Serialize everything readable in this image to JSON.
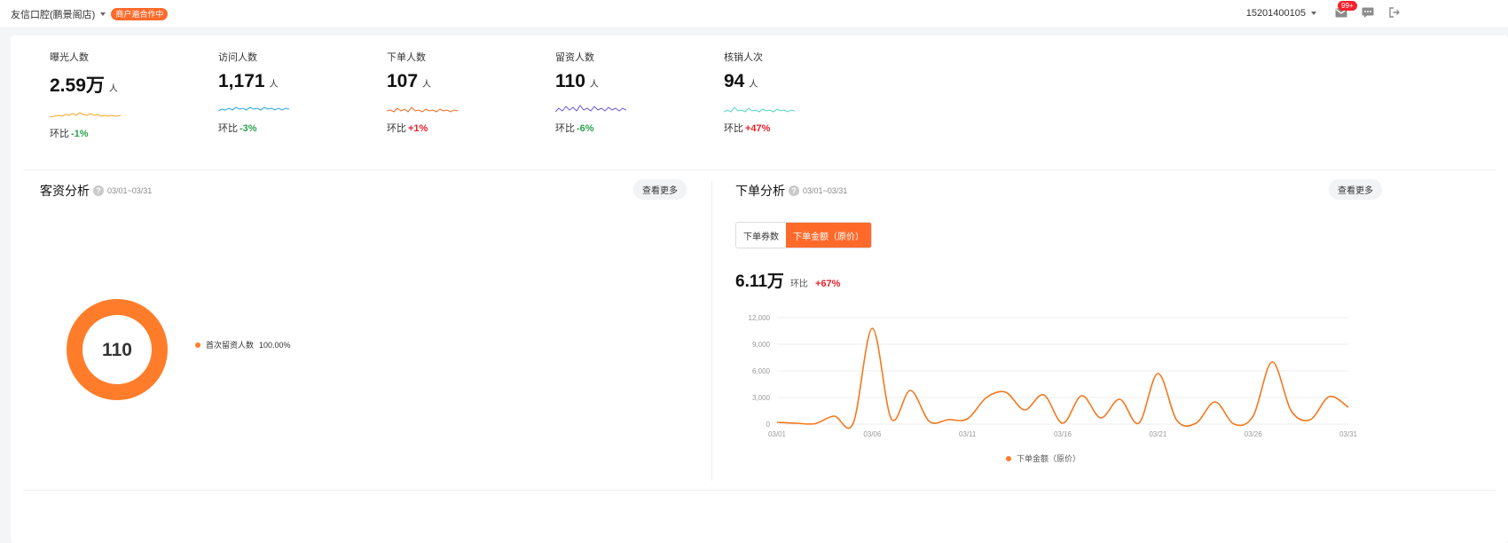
{
  "header": {
    "store_name": "友信口腔(鹏景阁店)",
    "coop_badge": "商户遍合作中",
    "account": "15201400105",
    "notif_count": "99+"
  },
  "metrics": [
    {
      "label": "曝光人数",
      "value": "2.59万",
      "unit": "人",
      "ratio_label": "环比",
      "ratio": "-1%",
      "trend": "down",
      "color": "#f5a623"
    },
    {
      "label": "访问人数",
      "value": "1,171",
      "unit": "人",
      "ratio_label": "环比",
      "ratio": "-3%",
      "trend": "down",
      "color": "#27a6e6"
    },
    {
      "label": "下单人数",
      "value": "107",
      "unit": "人",
      "ratio_label": "环比",
      "ratio": "+1%",
      "trend": "up",
      "color": "#f26b1d"
    },
    {
      "label": "留资人数",
      "value": "110",
      "unit": "人",
      "ratio_label": "环比",
      "ratio": "-6%",
      "trend": "down",
      "color": "#6b5bd6"
    },
    {
      "label": "核销人次",
      "value": "94",
      "unit": "人",
      "ratio_label": "环比",
      "ratio": "+47%",
      "trend": "up",
      "color": "#4dd6c8"
    }
  ],
  "customer_analysis": {
    "title": "客资分析",
    "range": "03/01~03/31",
    "more": "查看更多",
    "total": "110",
    "legend": {
      "name": "首次留资人数",
      "pct": "100.00%"
    },
    "ring_color": "#ff7d2a"
  },
  "order_analysis": {
    "title": "下单分析",
    "range": "03/01~03/31",
    "more": "查看更多",
    "tabs": [
      "下单券数",
      "下单金额（原价）"
    ],
    "active_tab": 1,
    "total": "6.11万",
    "ratio_label": "环比",
    "ratio": "+67%",
    "line_color": "#f2781f"
  },
  "chart_data": {
    "type": "line",
    "x": [
      "03/01",
      "03/02",
      "03/03",
      "03/04",
      "03/05",
      "03/06",
      "03/07",
      "03/08",
      "03/09",
      "03/10",
      "03/11",
      "03/12",
      "03/13",
      "03/14",
      "03/15",
      "03/16",
      "03/17",
      "03/18",
      "03/19",
      "03/20",
      "03/21",
      "03/22",
      "03/23",
      "03/24",
      "03/25",
      "03/26",
      "03/27",
      "03/28",
      "03/29",
      "03/30",
      "03/31"
    ],
    "x_ticks": [
      "03/01",
      "03/06",
      "03/11",
      "03/16",
      "03/21",
      "03/26",
      "03/31"
    ],
    "series": [
      {
        "name": "下单金额（原价）",
        "values": [
          200,
          100,
          50,
          900,
          100,
          10800,
          600,
          3800,
          300,
          500,
          600,
          3000,
          3600,
          1600,
          3300,
          100,
          3200,
          700,
          2800,
          100,
          5700,
          400,
          100,
          2500,
          0,
          900,
          7000,
          1500,
          500,
          3100,
          1900
        ]
      }
    ],
    "ylim": [
      0,
      12000
    ],
    "y_ticks": [
      "0",
      "3,000",
      "6,000",
      "9,000",
      "12,000"
    ],
    "legend_position": "bottom",
    "grid": true
  }
}
